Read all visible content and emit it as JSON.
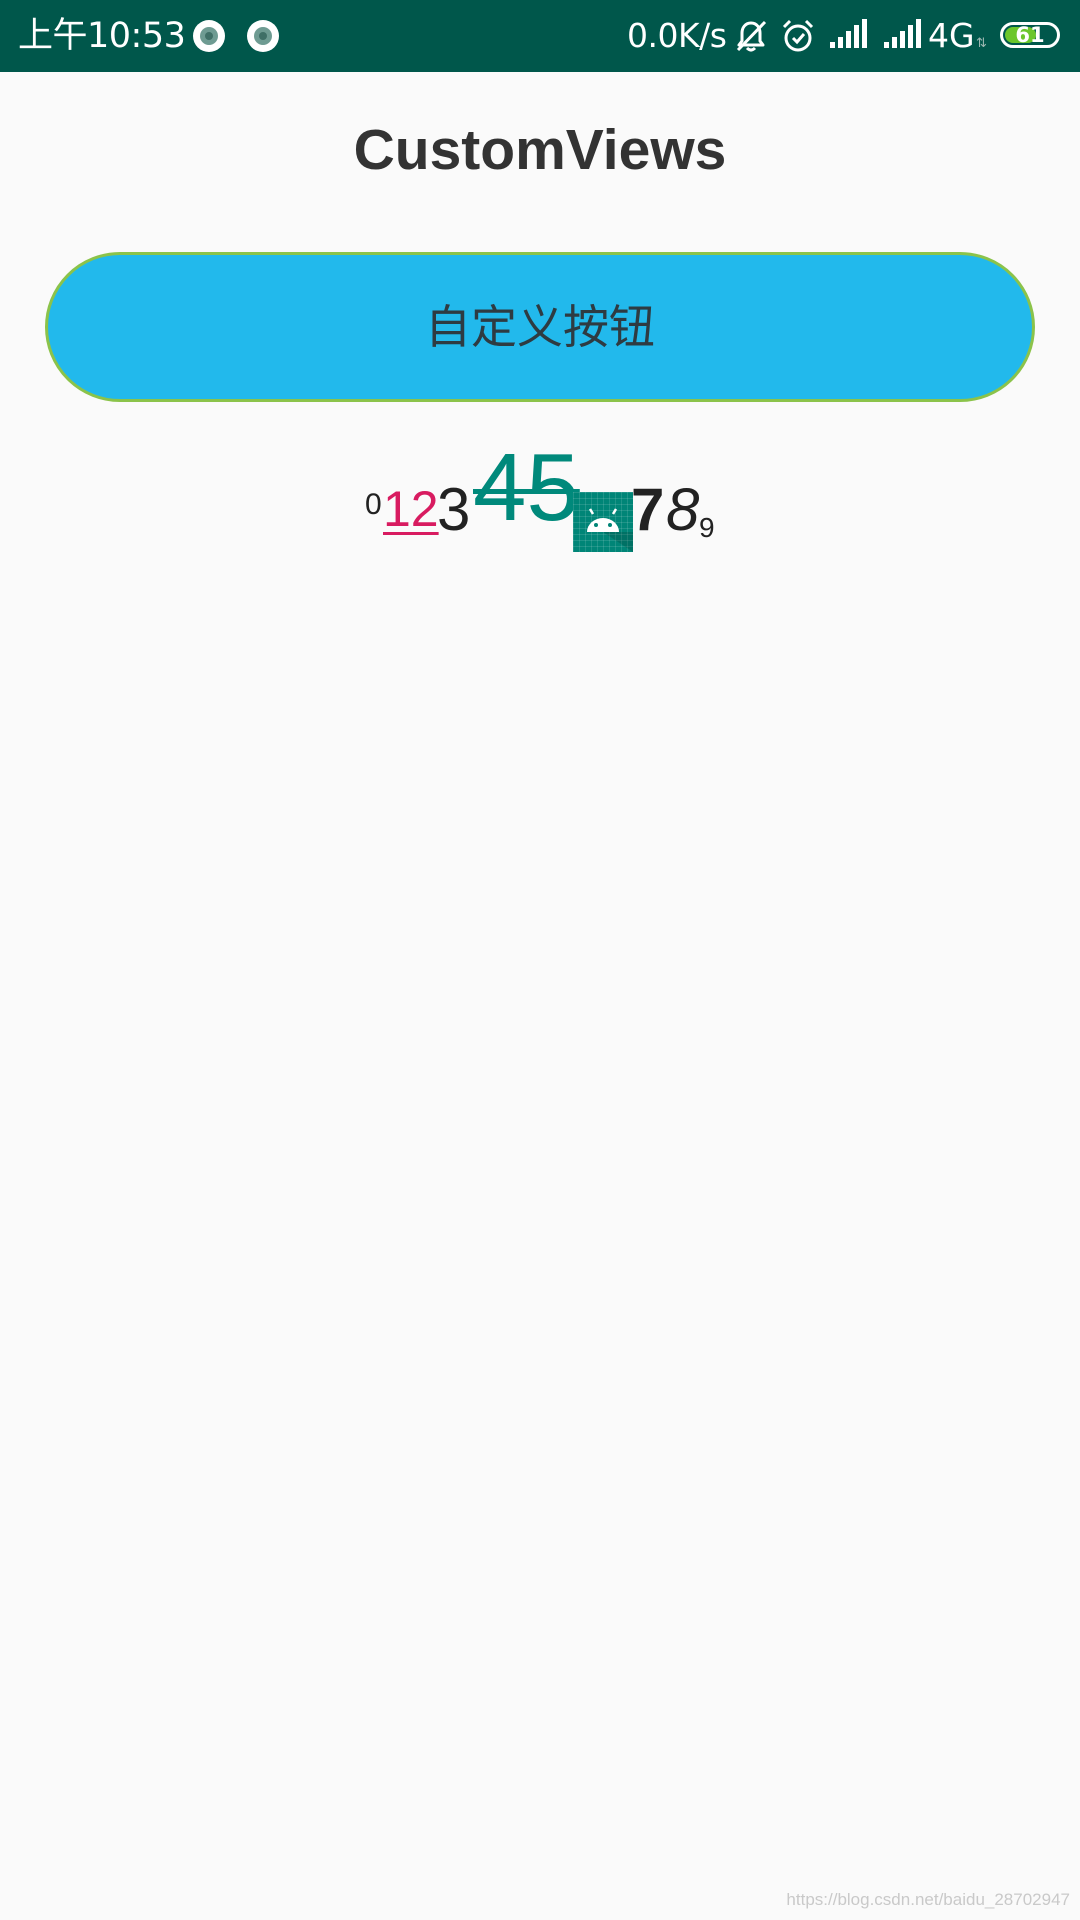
{
  "status_bar": {
    "time": "上午10:53",
    "net_speed": "0.0K/s",
    "network_type": "4G",
    "net_arrows": "⇅",
    "battery_level": "61",
    "battery_fraction": 0.61,
    "background_color": "#00574b",
    "icons": [
      "notification-icon",
      "notification-icon",
      "mute-bell-icon",
      "alarm-clock-icon",
      "signal-bars-icon",
      "signal-bars-icon",
      "battery-icon"
    ]
  },
  "app": {
    "title": "CustomViews"
  },
  "custom_button": {
    "label": "自定义按钮",
    "fill_color": "#22b9ec",
    "border_color": "#8bc34a"
  },
  "spannable_text": {
    "part_0": "0",
    "part_12": "12",
    "part_3": "3",
    "part_45": "45",
    "part_6_image": "android-icon",
    "part_7": "7",
    "part_8": "8",
    "part_9": "9",
    "colors": {
      "underline_color": "#d81b60",
      "strikethrough_color": "#00897b",
      "image_bg": "#008577"
    }
  },
  "watermark": {
    "text": "https://blog.csdn.net/baidu_28702947"
  }
}
